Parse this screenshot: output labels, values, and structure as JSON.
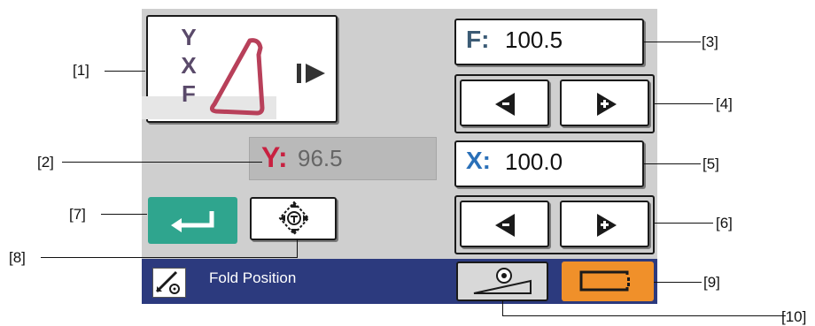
{
  "mode_selector": {
    "letters": [
      "Y",
      "X",
      "F"
    ]
  },
  "y_display": {
    "axis": "Y:",
    "value": "96.5"
  },
  "f_field": {
    "axis": "F:",
    "value": "100.5"
  },
  "x_field": {
    "axis": "X:",
    "value": "100.0"
  },
  "status_bar": {
    "label": "Fold Position"
  },
  "callouts": [
    "[1]",
    "[2]",
    "[3]",
    "[4]",
    "[5]",
    "[6]",
    "[7]",
    "[8]",
    "[9]",
    "[10]"
  ],
  "colors": {
    "panel": "#cfcfcf",
    "enter_button": "#2fa58e",
    "status_bar": "#2c3a7e",
    "paper_button": "#f0902a",
    "y_axis": "#c82040",
    "x_axis": "#2a70b8",
    "f_axis": "#3b5b75",
    "triangle": "#b8405a"
  },
  "icons": {
    "mode": "triangle-icon",
    "play": "play-icon",
    "enter": "enter-icon",
    "touch": "touch-move-icon",
    "fold": "fold-icon",
    "roller": "roller-icon",
    "paper": "paper-feed-icon",
    "decrease": "arrow-left-minus-icon",
    "increase": "arrow-right-plus-icon"
  }
}
